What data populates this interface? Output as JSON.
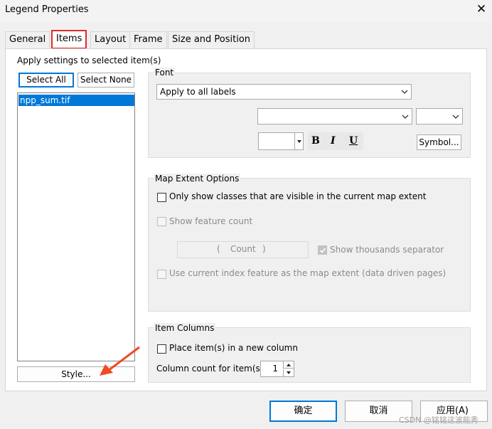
{
  "window": {
    "title": "Legend Properties",
    "close_glyph": "✕"
  },
  "tabs": [
    {
      "label": "General"
    },
    {
      "label": "Items"
    },
    {
      "label": "Layout"
    },
    {
      "label": "Frame"
    },
    {
      "label": "Size and Position"
    }
  ],
  "left": {
    "heading": "Apply settings to selected item(s)",
    "select_all": "Select All",
    "select_none": "Select None",
    "items": [
      "npp_sum.tif"
    ],
    "style_button": "Style..."
  },
  "font": {
    "group_title": "Font",
    "apply_to": "Apply to all labels",
    "font_name": "",
    "font_size": "",
    "color_value": "",
    "bold": "B",
    "italic": "I",
    "underline": "U",
    "symbol_button": "Symbol..."
  },
  "map_extent": {
    "group_title": "Map Extent Options",
    "only_visible": "Only show classes that are visible in the current map extent",
    "show_feature_count": "Show feature count",
    "count_open": "(",
    "count_label": "Count",
    "count_close": ")",
    "thousands_separator": "Show thousands separator",
    "use_index": "Use current index feature as the map extent (data driven pages)"
  },
  "item_columns": {
    "group_title": "Item Columns",
    "new_column": "Place item(s) in a new column",
    "column_count_label": "Column count for item(s)",
    "column_count": "1"
  },
  "footer": {
    "ok": "确定",
    "cancel": "取消",
    "apply": "应用(A)",
    "watermark": "CSDN @铭铭这波能秀"
  },
  "colors": {
    "accent": "#0078d7",
    "highlight": "#e12b2b",
    "arrow": "#f04a22"
  }
}
